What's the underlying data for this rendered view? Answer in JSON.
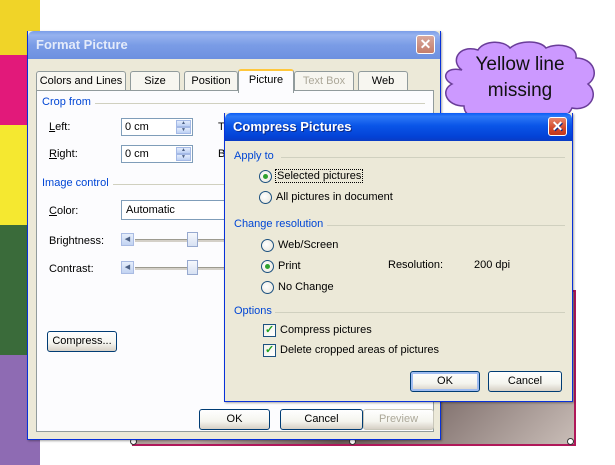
{
  "callout": {
    "text": "Yellow line missing"
  },
  "format_picture": {
    "title": "Format Picture",
    "tabs": [
      {
        "label": "Colors and Lines",
        "state": "normal"
      },
      {
        "label": "Size",
        "state": "normal"
      },
      {
        "label": "Position",
        "state": "normal"
      },
      {
        "label": "Picture",
        "state": "active"
      },
      {
        "label": "Text Box",
        "state": "disabled"
      },
      {
        "label": "Web",
        "state": "normal"
      }
    ],
    "crop_from": {
      "heading": "Crop from",
      "left_label": "Left:",
      "left_value": "0 cm",
      "right_label": "Right:",
      "right_value": "0 cm",
      "top_label_partial": "T",
      "bottom_label_partial": "B"
    },
    "image_control": {
      "heading": "Image control",
      "color_label": "Color:",
      "color_value": "Automatic",
      "brightness_label": "Brightness:",
      "contrast_label": "Contrast:"
    },
    "compress_button": "Compress...",
    "ok": "OK",
    "cancel": "Cancel",
    "preview": "Preview"
  },
  "compress_pictures": {
    "title": "Compress Pictures",
    "apply_to": {
      "heading": "Apply to",
      "options": [
        {
          "label": "Selected pictures",
          "selected": true
        },
        {
          "label": "All pictures in document",
          "selected": false
        }
      ]
    },
    "change_resolution": {
      "heading": "Change resolution",
      "options": [
        {
          "label": "Web/Screen",
          "selected": false
        },
        {
          "label": "Print",
          "selected": true
        },
        {
          "label": "No Change",
          "selected": false
        }
      ],
      "resolution_label": "Resolution:",
      "resolution_value": "200 dpi"
    },
    "options": {
      "heading": "Options",
      "items": [
        {
          "label": "Compress pictures",
          "checked": true
        },
        {
          "label": "Delete cropped areas of pictures",
          "checked": true
        }
      ]
    },
    "ok": "OK",
    "cancel": "Cancel"
  },
  "colors": {
    "xp_title_blue": "#0a55e8",
    "dialog_face": "#ece9d8",
    "group_heading": "#0046d5",
    "cloud_fill": "#cc99ff",
    "slide_border": "#b0185a"
  }
}
